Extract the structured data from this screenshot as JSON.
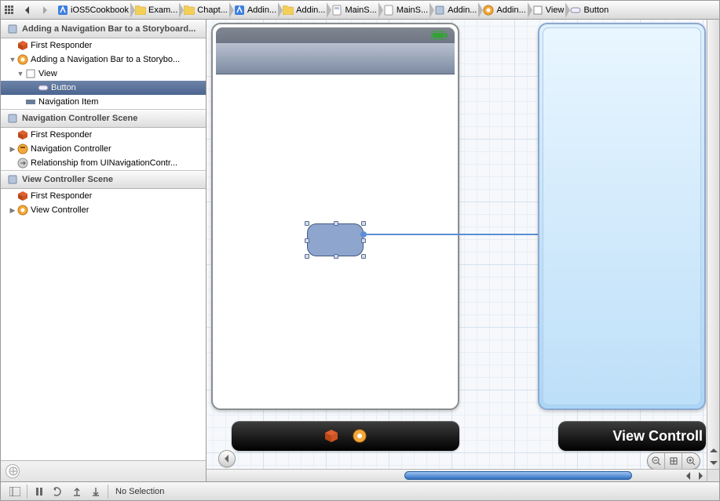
{
  "breadcrumb": [
    {
      "kind": "grid",
      "label": ""
    },
    {
      "kind": "nav-back",
      "label": ""
    },
    {
      "kind": "nav-fwd",
      "label": ""
    },
    {
      "kind": "xcode",
      "label": "iOS5Cookbook"
    },
    {
      "kind": "folder",
      "label": "Exam..."
    },
    {
      "kind": "folder",
      "label": "Chapt..."
    },
    {
      "kind": "xcode",
      "label": "Addin..."
    },
    {
      "kind": "folder",
      "label": "Addin..."
    },
    {
      "kind": "file",
      "label": "MainS..."
    },
    {
      "kind": "file",
      "label": "MainS..."
    },
    {
      "kind": "storyboard",
      "label": "Addin..."
    },
    {
      "kind": "scene",
      "label": "Addin..."
    },
    {
      "kind": "view",
      "label": "View"
    },
    {
      "kind": "button",
      "label": "Button"
    }
  ],
  "outline": {
    "scenes": [
      {
        "title": "Adding a Navigation Bar to a Storyboard...",
        "rows": [
          {
            "indent": 0,
            "disc": "",
            "icon": "cube",
            "label": "First Responder",
            "sel": false
          },
          {
            "indent": 0,
            "disc": "▼",
            "icon": "scene",
            "label": "Adding a Navigation Bar to a Storybo...",
            "sel": false
          },
          {
            "indent": 1,
            "disc": "▼",
            "icon": "view",
            "label": "View",
            "sel": false
          },
          {
            "indent": 2,
            "disc": "",
            "icon": "button",
            "label": "Button",
            "sel": true
          },
          {
            "indent": 1,
            "disc": "",
            "icon": "navitem",
            "label": "Navigation Item",
            "sel": false
          }
        ]
      },
      {
        "title": "Navigation Controller Scene",
        "rows": [
          {
            "indent": 0,
            "disc": "",
            "icon": "cube",
            "label": "First Responder",
            "sel": false
          },
          {
            "indent": 0,
            "disc": "▶",
            "icon": "navctrl",
            "label": "Navigation Controller",
            "sel": false
          },
          {
            "indent": 0,
            "disc": "",
            "icon": "rel",
            "label": "Relationship from UINavigationContr...",
            "sel": false
          }
        ]
      },
      {
        "title": "View Controller Scene",
        "rows": [
          {
            "indent": 0,
            "disc": "",
            "icon": "cube",
            "label": "First Responder",
            "sel": false
          },
          {
            "indent": 0,
            "disc": "▶",
            "icon": "scene",
            "label": "View Controller",
            "sel": false
          }
        ]
      }
    ]
  },
  "canvas": {
    "dock2_label": "View Controll"
  },
  "footer": {
    "selection": "No Selection"
  }
}
